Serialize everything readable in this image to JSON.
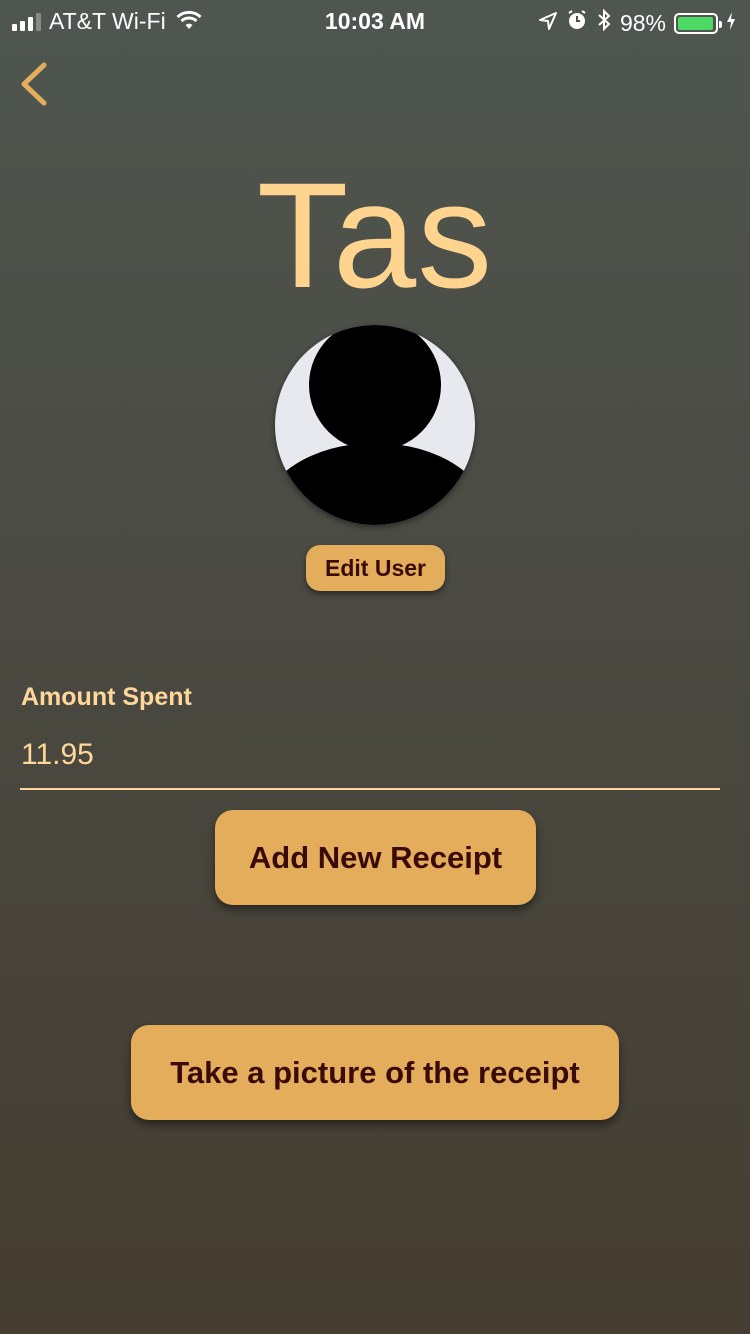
{
  "status_bar": {
    "carrier": "AT&T Wi-Fi",
    "time": "10:03 AM",
    "battery_percent": "98%",
    "battery_level": 0.98,
    "icons": [
      "signal-icon",
      "wifi-icon",
      "location-icon",
      "alarm-icon",
      "bluetooth-icon",
      "battery-icon",
      "charging-icon"
    ]
  },
  "nav": {
    "back_icon": "chevron-left-icon"
  },
  "profile": {
    "name": "Tas",
    "avatar_icon": "default-user-silhouette-icon",
    "edit_label": "Edit User"
  },
  "form": {
    "amount_label": "Amount Spent",
    "amount_value": "11.95"
  },
  "actions": {
    "add_receipt_label": "Add New Receipt",
    "take_picture_label": "Take a picture of the receipt"
  },
  "colors": {
    "accent": "#e4ad5c",
    "text_accent": "#ffd899",
    "button_text": "#3a0a06"
  }
}
